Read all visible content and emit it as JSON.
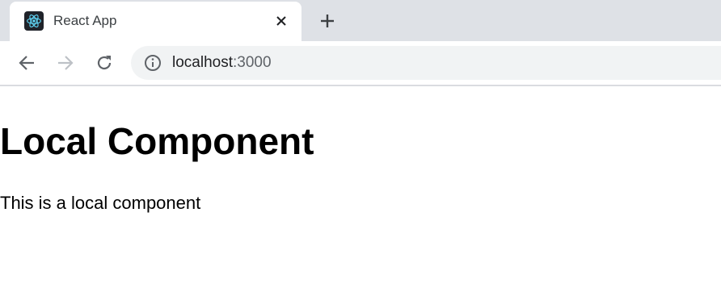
{
  "browser": {
    "tab": {
      "title": "React App",
      "favicon": "react-logo-icon"
    },
    "new_tab_icon": "plus-icon",
    "close_icon": "close-icon",
    "toolbar": {
      "back_icon": "arrow-left-icon",
      "forward_icon": "arrow-right-icon",
      "reload_icon": "reload-icon",
      "info_icon": "info-icon"
    },
    "address": {
      "host": "localhost",
      "port": ":3000"
    }
  },
  "page": {
    "heading": "Local Component",
    "paragraph": "This is a local component"
  },
  "colors": {
    "tab_strip": "#dee1e6",
    "omnibox": "#f1f3f4",
    "react_cyan": "#61dafb",
    "icon_gray": "#5f6368",
    "icon_disabled": "#bdc1c6"
  }
}
